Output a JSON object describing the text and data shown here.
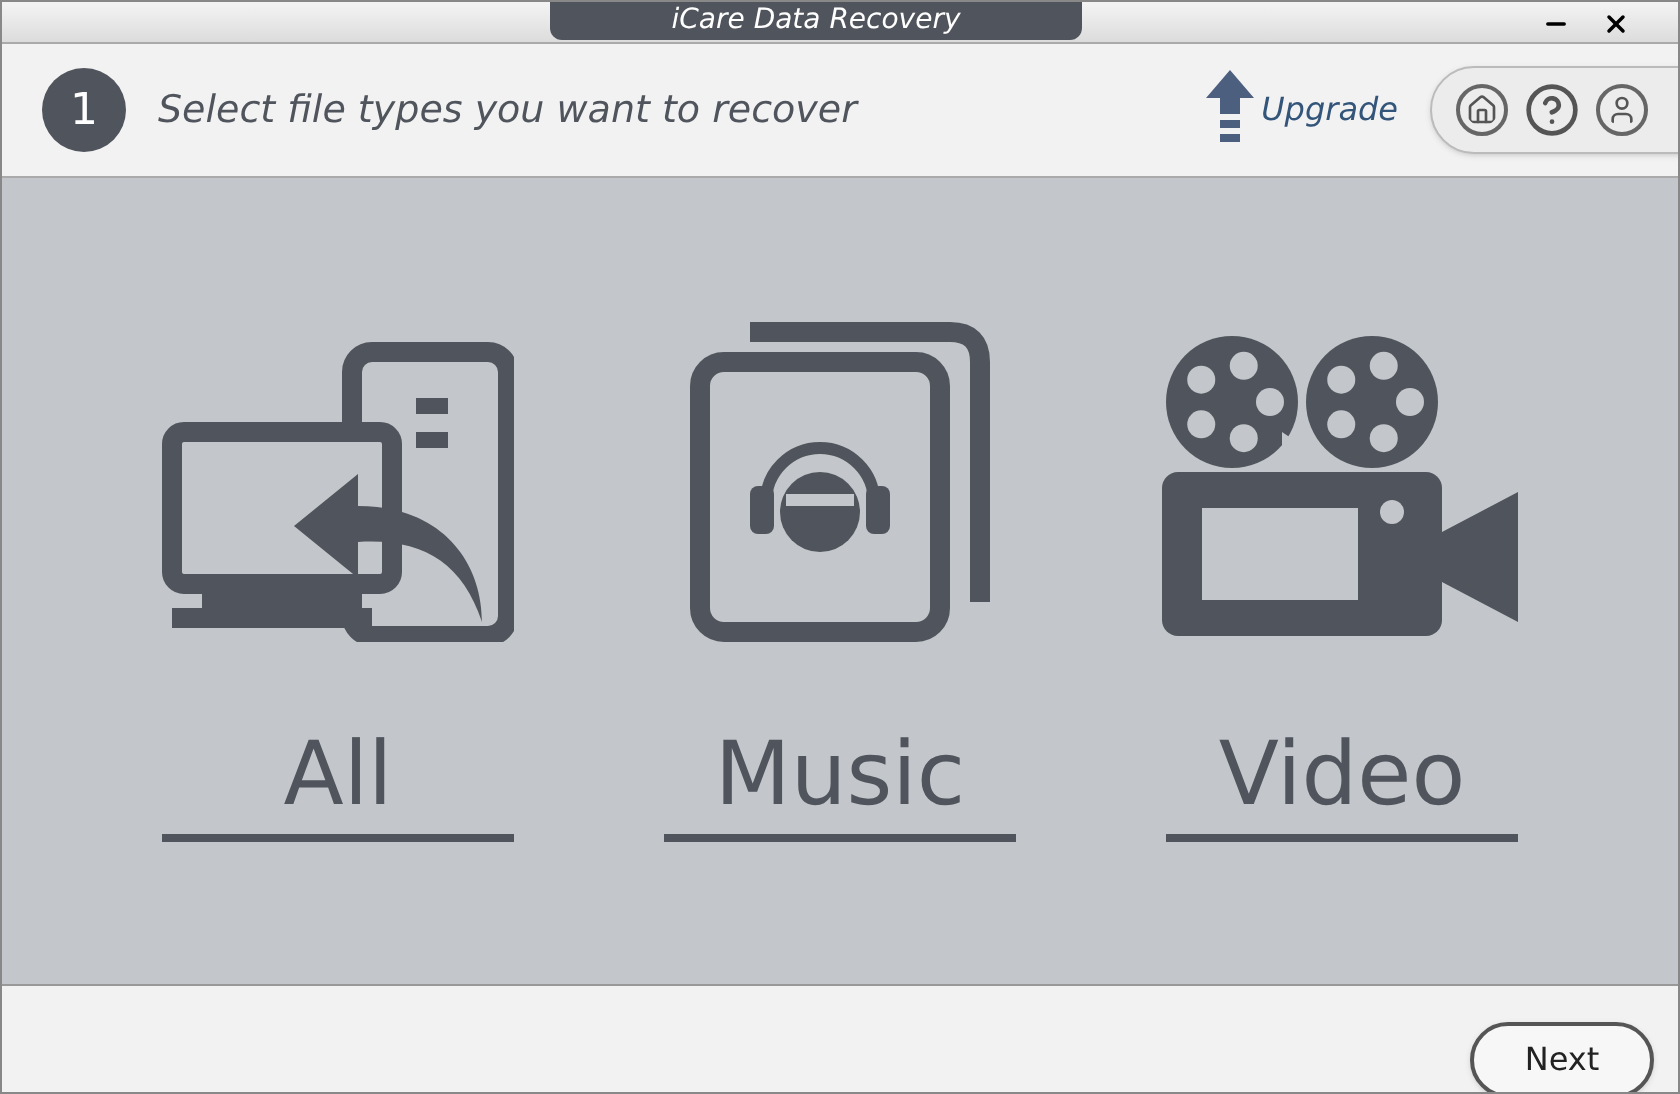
{
  "window": {
    "title": "iCare Data Recovery"
  },
  "header": {
    "step": "1",
    "title": "Select file types you want to recover",
    "upgrade": "Upgrade"
  },
  "options": [
    {
      "kind": "all",
      "label": "All"
    },
    {
      "kind": "music",
      "label": "Music"
    },
    {
      "kind": "video",
      "label": "Video"
    }
  ],
  "footer": {
    "next": "Next"
  }
}
